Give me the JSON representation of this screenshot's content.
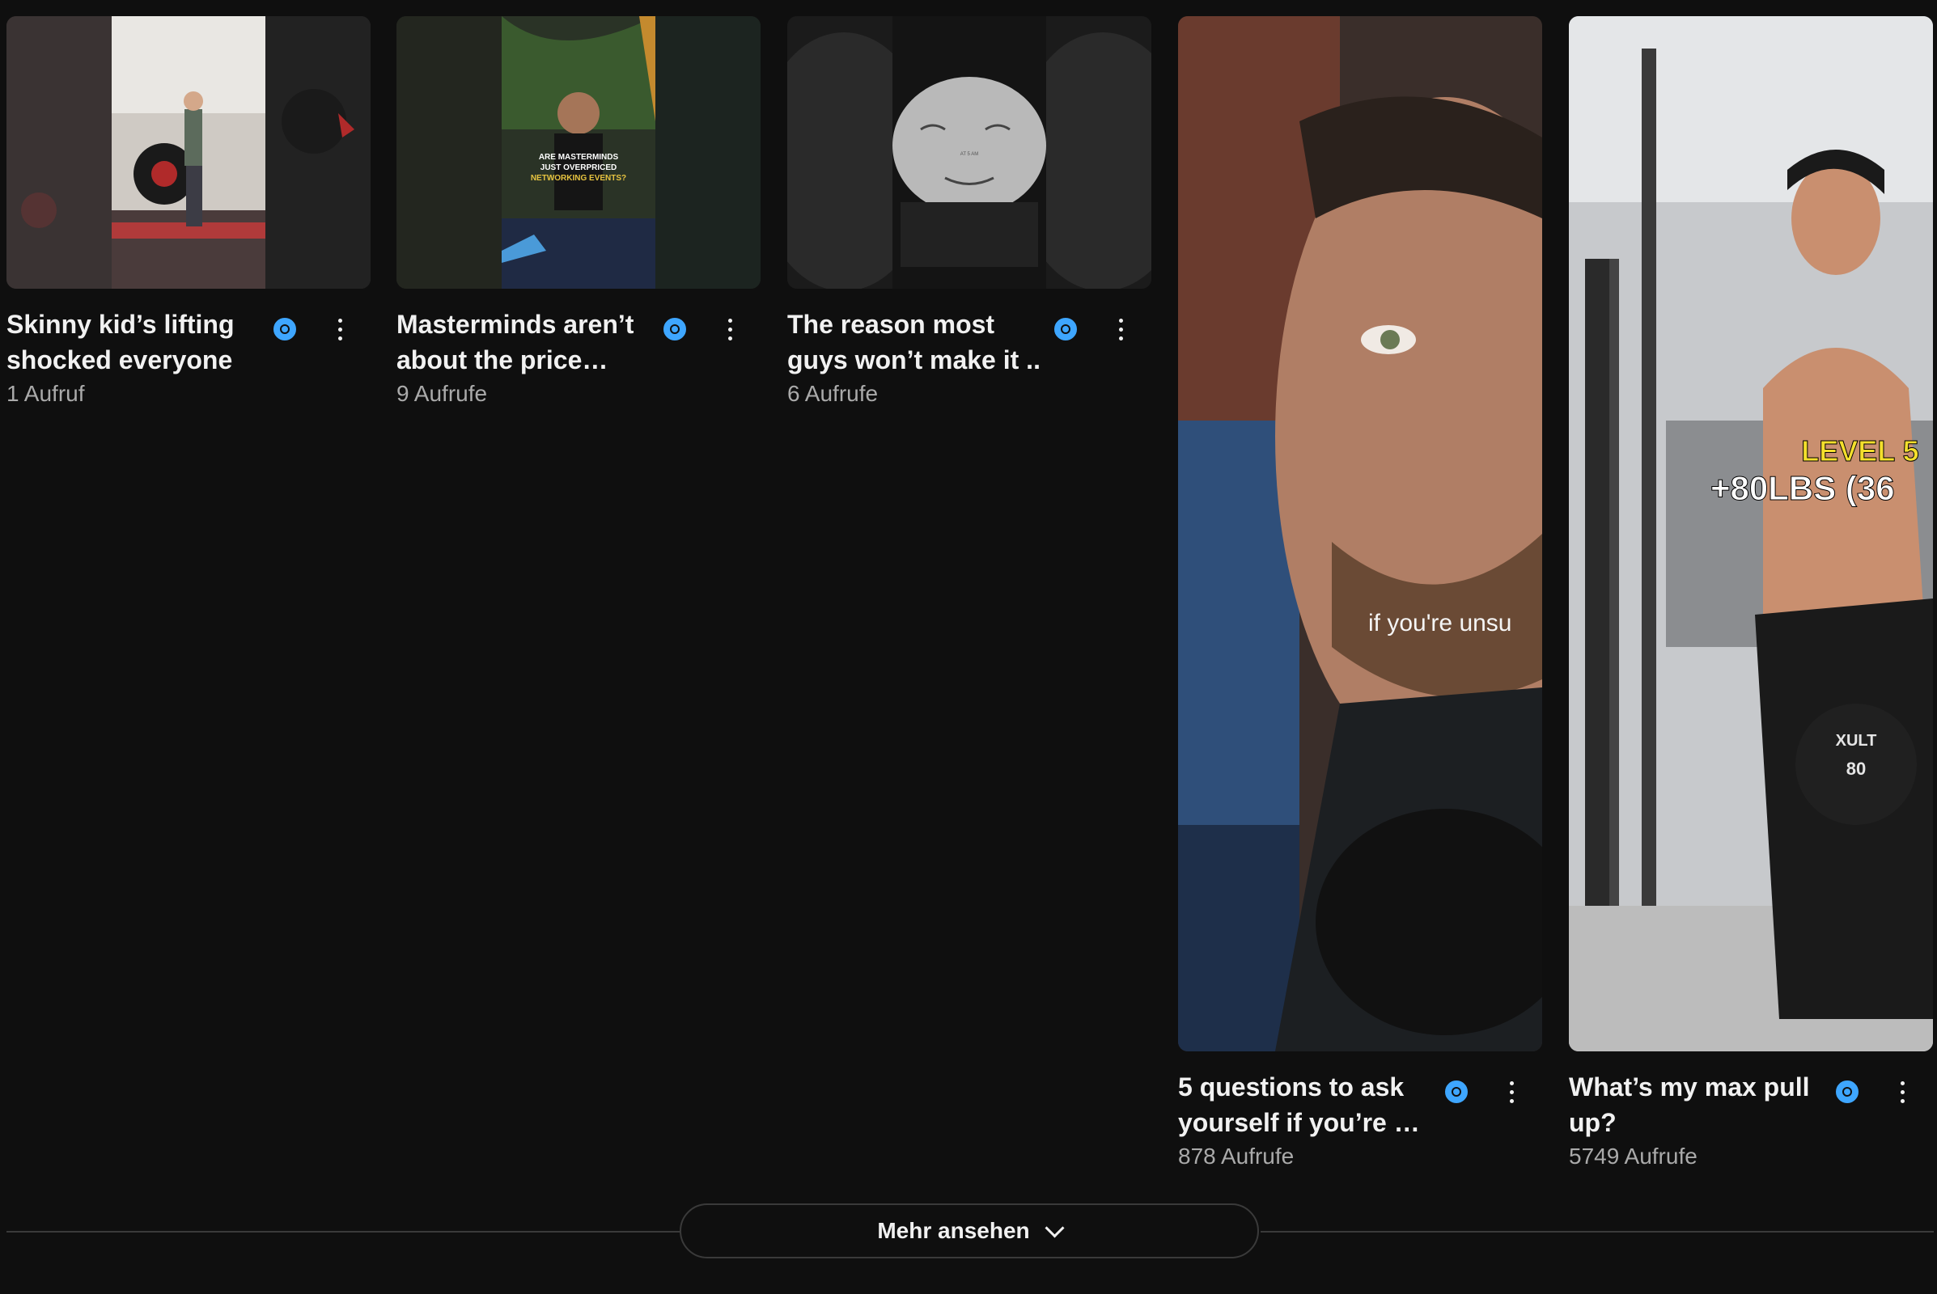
{
  "shorts": [
    {
      "title": "Skinny kid’s lifting shocked everyone",
      "views": "1 Aufruf",
      "thumb": "gym-deadlift-thumbnail"
    },
    {
      "title": "Masterminds aren’t about the price tag…",
      "views": "9 Aufrufe",
      "thumb": "podcast-guest-thumbnail",
      "overlay": [
        "ARE MASTERMINDS",
        "JUST OVERPRICED",
        "NETWORKING EVENTS?"
      ]
    },
    {
      "title": "The reason most guys won’t make it ..",
      "views": "6 Aufrufe",
      "thumb": "meme-face-thumbnail",
      "overlay": [
        "AT 5 AM"
      ]
    },
    {
      "title": "5 questions to ask yourself if you’re …",
      "views": "878 Aufrufe",
      "thumb": "man-closeup-thumbnail",
      "overlay": [
        "if you're unsu"
      ]
    },
    {
      "title": "What’s my max pull up?",
      "views": "5749 Aufrufe",
      "thumb": "pullup-weight-thumbnail",
      "overlay": [
        "LEVEL 5",
        "+80LBS (36",
        "XULT",
        "80"
      ]
    }
  ],
  "show_more": {
    "label": "Mehr ansehen",
    "icon": "chevron-down-icon"
  },
  "colors": {
    "background": "#0f0f0f",
    "accent": "#3ea6ff",
    "text": "#f1f1f1",
    "secondary_text": "#aaaaaa"
  }
}
